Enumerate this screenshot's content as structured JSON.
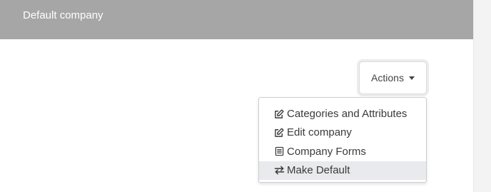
{
  "header": {
    "title": "Default company"
  },
  "actions": {
    "label": "Actions"
  },
  "menu": {
    "items": [
      {
        "label": "Categories and Attributes",
        "icon": "edit-icon"
      },
      {
        "label": "Edit company",
        "icon": "edit-icon"
      },
      {
        "label": "Company Forms",
        "icon": "form-icon"
      },
      {
        "label": "Make Default",
        "icon": "exchange-icon",
        "highlighted": true
      }
    ]
  },
  "colors": {
    "header_background": "#a6a6a6",
    "header_text": "#ffffff",
    "highlight_row": "#e9eaed"
  }
}
